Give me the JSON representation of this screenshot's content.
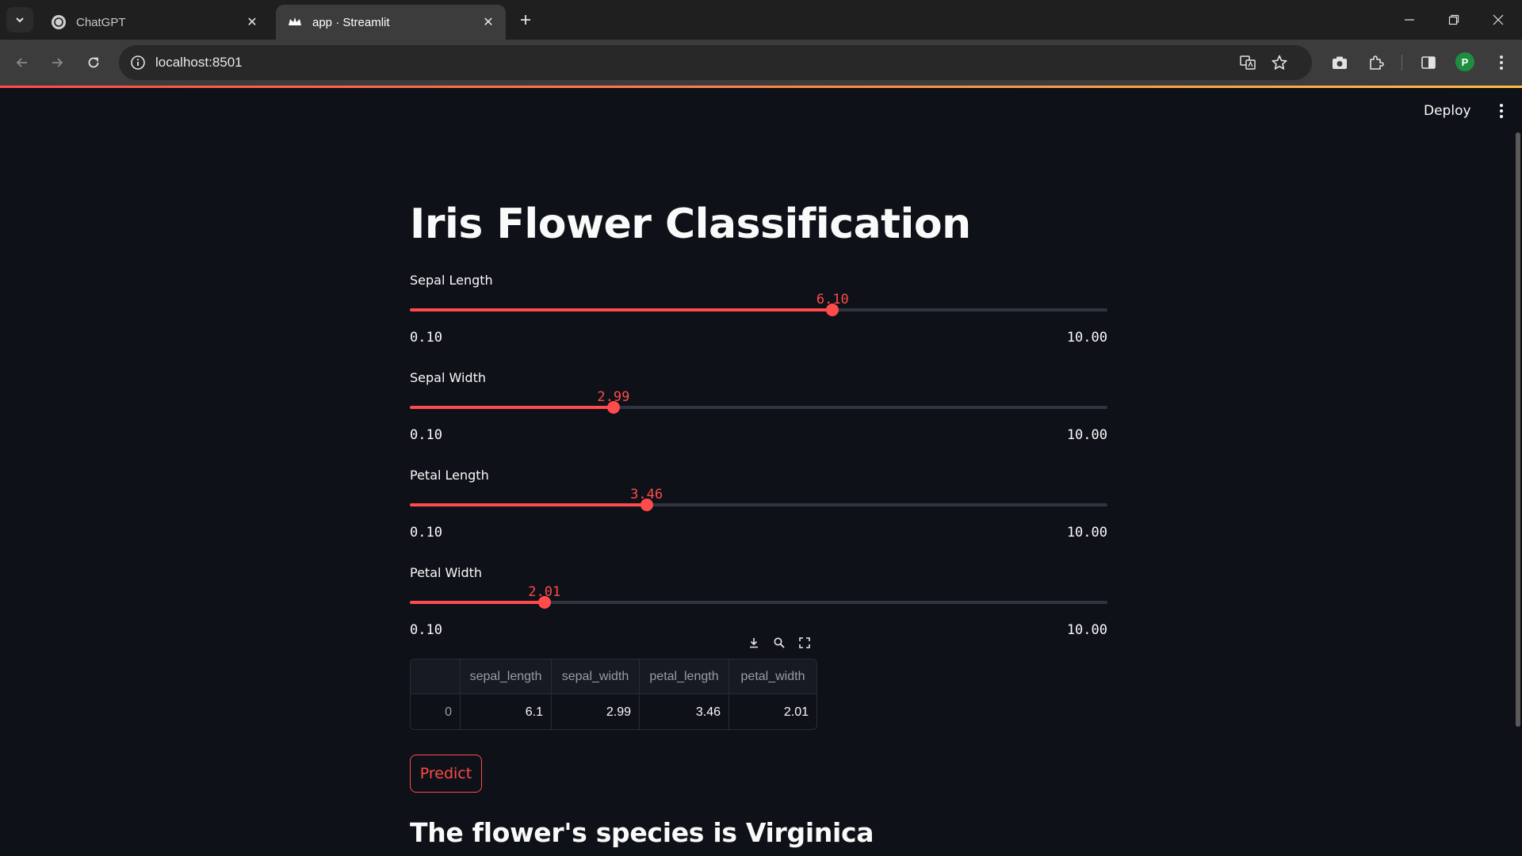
{
  "browser": {
    "tabs": [
      {
        "title": "ChatGPT",
        "active": false
      },
      {
        "title": "app · Streamlit",
        "active": true
      }
    ],
    "url": "localhost:8501"
  },
  "app": {
    "deploy_label": "Deploy",
    "title": "Iris Flower Classification",
    "sliders": [
      {
        "label": "Sepal Length",
        "value": "6.10",
        "min": "0.10",
        "max": "10.00",
        "numeric_value": 6.1
      },
      {
        "label": "Sepal Width",
        "value": "2.99",
        "min": "0.10",
        "max": "10.00",
        "numeric_value": 2.99
      },
      {
        "label": "Petal Length",
        "value": "3.46",
        "min": "0.10",
        "max": "10.00",
        "numeric_value": 3.46
      },
      {
        "label": "Petal Width",
        "value": "2.01",
        "min": "0.10",
        "max": "10.00",
        "numeric_value": 2.01
      }
    ],
    "dataframe": {
      "columns": [
        "",
        "sepal_length",
        "sepal_width",
        "petal_length",
        "petal_width"
      ],
      "rows": [
        [
          "0",
          "6.1",
          "2.99",
          "3.46",
          "2.01"
        ]
      ]
    },
    "predict_label": "Predict",
    "result_text": "The flower's species is Virginica"
  },
  "colors": {
    "accent": "#ff4b4b",
    "background": "#0e1117",
    "text": "#fafafa"
  }
}
